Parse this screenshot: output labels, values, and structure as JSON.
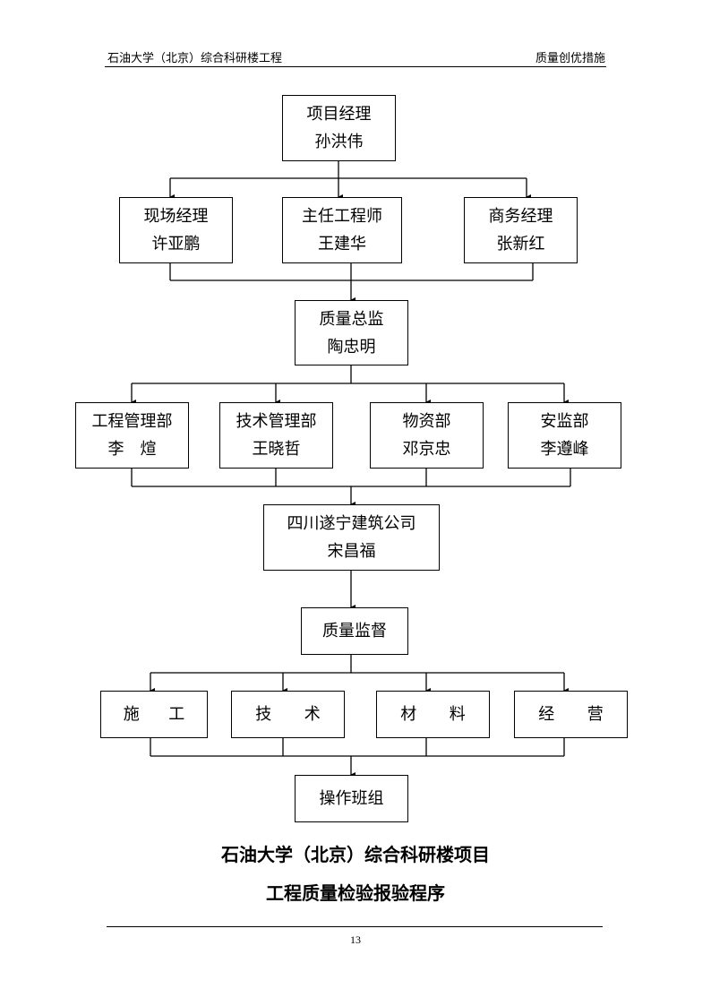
{
  "header": {
    "left": "石油大学（北京）综合科研楼工程",
    "right": "质量创优措施"
  },
  "org_chart": {
    "project_manager": {
      "title": "项目经理",
      "name": "孙洪伟"
    },
    "level2": [
      {
        "title": "现场经理",
        "name": "许亚鹏"
      },
      {
        "title": "主任工程师",
        "name": "王建华"
      },
      {
        "title": "商务经理",
        "name": "张新红"
      }
    ],
    "quality_director": {
      "title": "质量总监",
      "name": "陶忠明"
    },
    "departments": [
      {
        "title": "工程管理部",
        "name": "李　煊"
      },
      {
        "title": "技术管理部",
        "name": "王晓哲"
      },
      {
        "title": "物资部",
        "name": "邓京忠"
      },
      {
        "title": "安监部",
        "name": "李遵峰"
      }
    ],
    "subcontractor": {
      "title": "四川遂宁建筑公司",
      "name": "宋昌福"
    },
    "quality_supervision": {
      "title": "质量监督"
    },
    "functions": [
      {
        "left": "施",
        "right": "工"
      },
      {
        "left": "技",
        "right": "术"
      },
      {
        "left": "材",
        "right": "料"
      },
      {
        "left": "经",
        "right": "营"
      }
    ],
    "teams": {
      "title": "操作班组"
    }
  },
  "titles": {
    "line1": "石油大学（北京）综合科研楼项目",
    "line2": "工程质量检验报验程序"
  },
  "footer": {
    "page_number": "13"
  }
}
